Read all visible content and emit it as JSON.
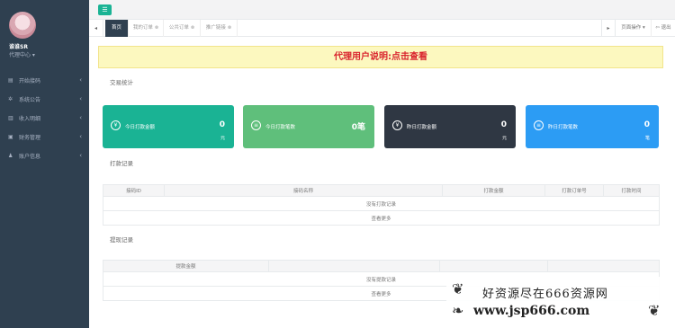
{
  "sidebar": {
    "username": "谁谁SR",
    "role": "代理中心 ▾",
    "items": [
      {
        "label": "开始接码",
        "icon": "list-icon"
      },
      {
        "label": "系统公告",
        "icon": "gear-icon"
      },
      {
        "label": "收入明细",
        "icon": "chart-icon"
      },
      {
        "label": "财务管理",
        "icon": "wallet-icon"
      },
      {
        "label": "账户信息",
        "icon": "users-icon"
      }
    ]
  },
  "topbar": {
    "toggle": "☰"
  },
  "tabs": {
    "back": "◂",
    "items": [
      {
        "label": "首页",
        "active": true
      },
      {
        "label": "我的订单",
        "active": false
      },
      {
        "label": "公共订单",
        "active": false
      },
      {
        "label": "推广链接",
        "active": false
      }
    ],
    "forward": "▸",
    "actions": "页面操作 ▾",
    "logout": "⇦ 退出"
  },
  "notice": "代理用户说明:点击查看",
  "stats": {
    "title": "交易统计",
    "cards": [
      {
        "label": "今日打款金额",
        "value": "0",
        "unit": "元",
        "color": "#1ab394"
      },
      {
        "label": "今日打款笔数",
        "value": "0笔",
        "unit": "",
        "color": "#5fbf7b"
      },
      {
        "label": "昨日打款金额",
        "value": "0",
        "unit": "元",
        "color": "#2f3743"
      },
      {
        "label": "昨日打款笔数",
        "value": "0",
        "unit": "笔",
        "color": "#2c9cf4"
      }
    ]
  },
  "payments": {
    "title": "打款记录",
    "headers": [
      "接码ID",
      "接码名称",
      "打款金额",
      "打款订单号",
      "打款时间"
    ],
    "empty": "没有打款记录",
    "more": "查看更多"
  },
  "withdrawals": {
    "title": "提现记录",
    "headers": [
      "提款金额",
      "",
      "",
      ""
    ],
    "empty": "没有提款记录",
    "more": "查看更多"
  },
  "watermark": {
    "line1": "好资源尽在666资源网",
    "line2": "www.jsp666.com"
  }
}
